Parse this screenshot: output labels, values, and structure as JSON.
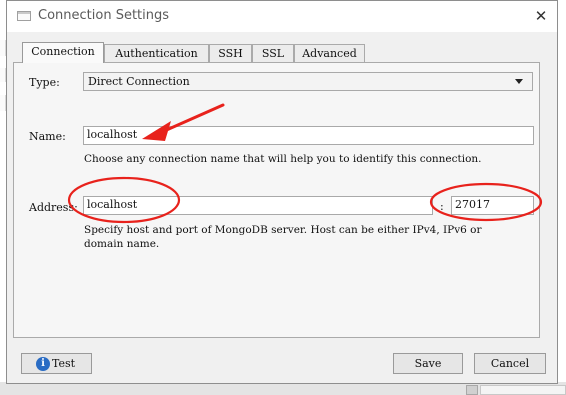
{
  "dialog": {
    "title": "Connection Settings",
    "close_glyph": "✕"
  },
  "tabs": [
    {
      "label": "Connection",
      "active": true
    },
    {
      "label": "Authentication",
      "active": false
    },
    {
      "label": "SSH",
      "active": false
    },
    {
      "label": "SSL",
      "active": false
    },
    {
      "label": "Advanced",
      "active": false
    }
  ],
  "form": {
    "type_label": "Type:",
    "type_value": "Direct Connection",
    "name_label": "Name:",
    "name_value": "localhost",
    "name_help": "Choose any connection name that will help you to identify this connection.",
    "address_label": "Address:",
    "host_value": "localhost",
    "port_separator": ":",
    "port_value": "27017",
    "address_help_line1": "Specify host and port of MongoDB server. Host can be either IPv4, IPv6 or",
    "address_help_line2": "domain name."
  },
  "buttons": {
    "test_label": "Test",
    "save_label": "Save",
    "cancel_label": "Cancel"
  },
  "icons": {
    "info": "i",
    "app": "window-icon",
    "dropdown": "chevron-down-icon"
  },
  "colors": {
    "annotation_red": "#e8221c",
    "info_blue": "#2a6cc4"
  }
}
